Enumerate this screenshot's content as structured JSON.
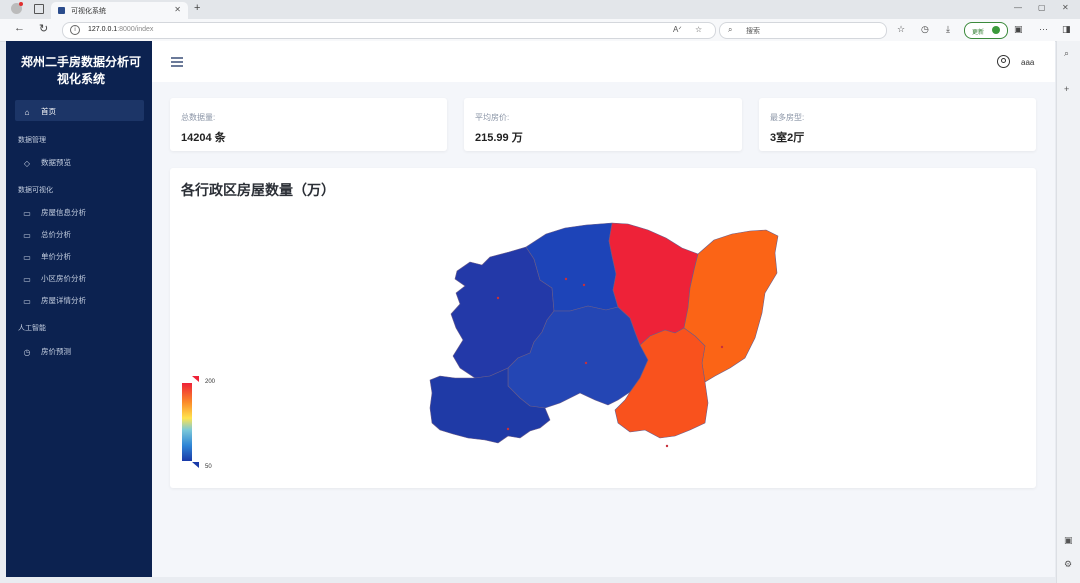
{
  "browser": {
    "tab_title": "可视化系统",
    "tab_close": "✕",
    "new_tab": "+",
    "url_host": "127.0.0.1",
    "url_rest": ":8000/index",
    "search_placeholder": "搜索",
    "update_label": "更新"
  },
  "app": {
    "title_line1": "郑州二手房数据分析可",
    "title_line2": "视化系统",
    "user_name": "aaa"
  },
  "sidebar": {
    "home": "首页",
    "group_data": "数据管理",
    "data_preview": "数据预览",
    "group_vis": "数据可视化",
    "house_info": "房屋信息分析",
    "total_price": "总价分析",
    "unit_price": "单价分析",
    "community_price": "小区房价分析",
    "house_detail": "房屋详情分析",
    "group_ai": "人工智能",
    "price_predict": "房价预测"
  },
  "stats": [
    {
      "label": "总数据量:",
      "value": "14204 条"
    },
    {
      "label": "平均房价:",
      "value": "215.99 万"
    },
    {
      "label": "最多房型:",
      "value": "3室2厅"
    }
  ],
  "chart_data": {
    "type": "map",
    "title": "各行政区房屋数量（万）",
    "visual_map": {
      "min": 50,
      "max": 200,
      "min_label": "50",
      "max_label": "200",
      "colors": [
        "#313695",
        "#4575b4",
        "#74add1",
        "#abd9e9",
        "#e0f3f8",
        "#ffffbf",
        "#fee090",
        "#fdae61",
        "#f46d43",
        "#d73027",
        "#a50026"
      ]
    },
    "regions_rendered": [
      {
        "area": "west",
        "level": "low",
        "color": "#2339a8"
      },
      {
        "area": "north-central",
        "level": "low",
        "color": "#1d44b8"
      },
      {
        "area": "central",
        "level": "low",
        "color": "#2446b4"
      },
      {
        "area": "south-west",
        "level": "low",
        "color": "#1f3aa6"
      },
      {
        "area": "north-east",
        "level": "high",
        "color": "#ee2238"
      },
      {
        "area": "east",
        "level": "high",
        "color": "#fb6416"
      },
      {
        "area": "south-east",
        "level": "high",
        "color": "#f9521d"
      }
    ]
  },
  "colors": {
    "sidebar_bg": "#0c2250",
    "accent": "#1c3567",
    "update_green": "#3c8a3c"
  }
}
